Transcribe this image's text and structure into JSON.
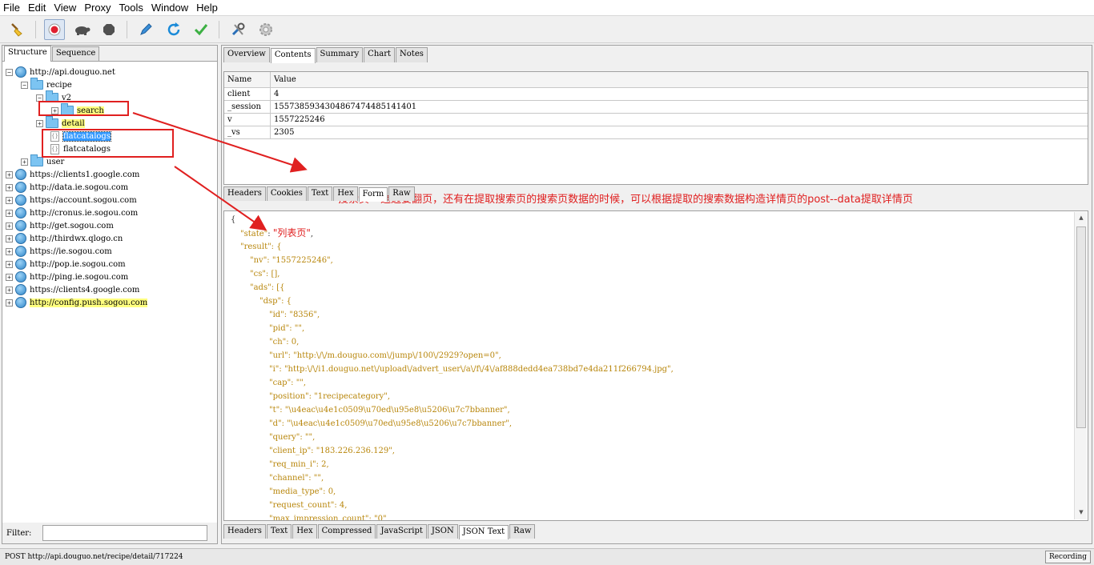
{
  "menu": [
    "File",
    "Edit",
    "View",
    "Proxy",
    "Tools",
    "Window",
    "Help"
  ],
  "toolbar": {
    "icons": [
      "broom-icon",
      "record-icon",
      "turtle-icon",
      "stop-icon",
      "pen-icon",
      "refresh-icon",
      "check-icon",
      "tools-icon",
      "settings-icon"
    ]
  },
  "left_tabs": [
    "Structure",
    "Sequence"
  ],
  "tree": {
    "root": "http://api.douguo.net",
    "recipe": "recipe",
    "v2": "v2",
    "search": "search",
    "detail": "detail",
    "flatcatalogs_1": "flatcatalogs",
    "flatcatalogs_2": "flatcatalogs",
    "user": "user",
    "hosts": [
      "https://clients1.google.com",
      "http://data.ie.sogou.com",
      "https://account.sogou.com",
      "http://cronus.ie.sogou.com",
      "http://get.sogou.com",
      "http://thirdwx.qlogo.cn",
      "https://ie.sogou.com",
      "http://pop.ie.sogou.com",
      "http://ping.ie.sogou.com",
      "https://clients4.google.com",
      "http://config.push.sogou.com"
    ]
  },
  "filter_label": "Filter:",
  "right_tabs": [
    "Overview",
    "Contents",
    "Summary",
    "Chart",
    "Notes"
  ],
  "params_grid": {
    "headers": [
      "Name",
      "Value"
    ],
    "rows": [
      [
        "client",
        "4"
      ],
      [
        "_session",
        "1557385934304867474485141401"
      ],
      [
        "v",
        "1557225246"
      ],
      [
        "_vs",
        "2305"
      ]
    ]
  },
  "annotation": "搜索页---这边要翻页，还有在提取搜索页的搜索页数据的时候，可以根据提取的搜索数据构造详情页的post--data提取详情页",
  "request_tabs": [
    "Headers",
    "Cookies",
    "Text",
    "Hex",
    "Form",
    "Raw"
  ],
  "response_tabs": [
    "Headers",
    "Text",
    "Hex",
    "Compressed",
    "JavaScript",
    "JSON",
    "JSON Text",
    "Raw"
  ],
  "json_lines": {
    "l0": "{",
    "l1_key": "\"state\"",
    "l1_val": "\"列表页\"",
    "l2": "\"result\": {",
    "l3": "\"nv\": \"1557225246\",",
    "l4": "\"cs\": [],",
    "l5": "\"ads\": [{",
    "l6": "\"dsp\": {",
    "l7": "\"id\": \"8356\",",
    "l8": "\"pid\": \"\",",
    "l9": "\"ch\": 0,",
    "l10": "\"url\": \"http:\\/\\/m.douguo.com\\/jump\\/100\\/2929?open=0\",",
    "l11": "\"i\": \"http:\\/\\/i1.douguo.net\\/upload\\/advert_user\\/a\\/f\\/4\\/af888dedd4ea738bd7e4da211f266794.jpg\",",
    "l12": "\"cap\": \"\",",
    "l13": "\"position\": \"1recipecategory\",",
    "l14": "\"t\": \"\\u4eac\\u4e1c0509\\u70ed\\u95e8\\u5206\\u7c7bbanner\",",
    "l15": "\"d\": \"\\u4eac\\u4e1c0509\\u70ed\\u95e8\\u5206\\u7c7bbanner\",",
    "l16": "\"query\": \"\",",
    "l17": "\"client_ip\": \"183.226.236.129\",",
    "l18": "\"req_min_i\": 2,",
    "l19": "\"channel\": \"\",",
    "l20": "\"media_type\": 0,",
    "l21": "\"request_count\": 4,",
    "l22": "\"max_impression_count\": \"0\""
  },
  "status": {
    "text": "POST http://api.douguo.net/recipe/detail/717224",
    "recording": "Recording"
  },
  "colors": {
    "annotation": "#e02020",
    "json_key": "#b8860b",
    "highlight": "#ffff80",
    "selection": "#3399ff"
  }
}
